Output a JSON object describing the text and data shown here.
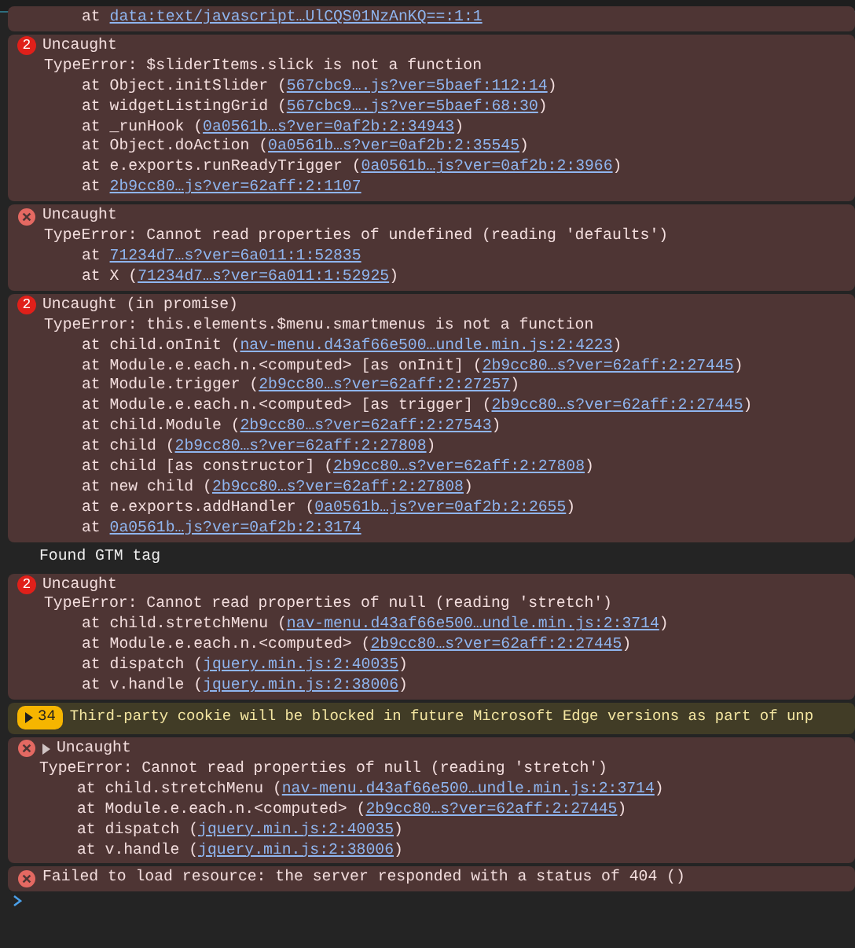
{
  "messages": [
    {
      "kind": "error",
      "toggle": false,
      "frames": [
        {
          "pre": "at ",
          "link": "data:text/javascript…UlCQS01NzAnKQ==:1:1"
        }
      ]
    },
    {
      "kind": "error",
      "toggle": false,
      "count": "2",
      "title": "Uncaught",
      "error": "TypeError: $sliderItems.slick is not a function",
      "frames": [
        {
          "pre": "at Object.initSlider (",
          "link": "567cbc9….js?ver=5baef:112:14",
          "post": ")"
        },
        {
          "pre": "at widgetListingGrid (",
          "link": "567cbc9….js?ver=5baef:68:30",
          "post": ")"
        },
        {
          "pre": "at _runHook (",
          "link": "0a0561b…s?ver=0af2b:2:34943",
          "post": ")"
        },
        {
          "pre": "at Object.doAction (",
          "link": "0a0561b…s?ver=0af2b:2:35545",
          "post": ")"
        },
        {
          "pre": "at e.exports.runReadyTrigger (",
          "link": "0a0561b…js?ver=0af2b:2:3966",
          "post": ")"
        },
        {
          "pre": "at ",
          "link": "2b9cc80…js?ver=62aff:2:1107"
        }
      ]
    },
    {
      "kind": "error",
      "toggle": false,
      "title": "Uncaught",
      "error": "TypeError: Cannot read properties of undefined (reading 'defaults')",
      "frames": [
        {
          "pre": "at ",
          "link": "71234d7…s?ver=6a011:1:52835"
        },
        {
          "pre": "at X (",
          "link": "71234d7…s?ver=6a011:1:52925",
          "post": ")"
        }
      ]
    },
    {
      "kind": "error",
      "toggle": false,
      "count": "2",
      "title": "Uncaught (in promise)",
      "error": "TypeError: this.elements.$menu.smartmenus is not a function",
      "frames": [
        {
          "pre": "at child.onInit (",
          "link": "nav-menu.d43af66e500…undle.min.js:2:4223",
          "post": ")"
        },
        {
          "pre": "at Module.e.each.n.<computed> [as onInit] (",
          "link": "2b9cc80…s?ver=62aff:2:27445",
          "post": ")"
        },
        {
          "pre": "at Module.trigger (",
          "link": "2b9cc80…s?ver=62aff:2:27257",
          "post": ")"
        },
        {
          "pre": "at Module.e.each.n.<computed> [as trigger] (",
          "link": "2b9cc80…s?ver=62aff:2:27445",
          "post": ")"
        },
        {
          "pre": "at child.Module (",
          "link": "2b9cc80…s?ver=62aff:2:27543",
          "post": ")"
        },
        {
          "pre": "at child (",
          "link": "2b9cc80…s?ver=62aff:2:27808",
          "post": ")"
        },
        {
          "pre": "at child [as constructor] (",
          "link": "2b9cc80…s?ver=62aff:2:27808",
          "post": ")"
        },
        {
          "pre": "at new child (",
          "link": "2b9cc80…s?ver=62aff:2:27808",
          "post": ")"
        },
        {
          "pre": "at e.exports.addHandler (",
          "link": "0a0561b…js?ver=0af2b:2:2655",
          "post": ")"
        },
        {
          "pre": "at ",
          "link": "0a0561b…js?ver=0af2b:2:3174"
        }
      ]
    },
    {
      "kind": "info",
      "toggle": false,
      "title": "Found GTM tag"
    },
    {
      "kind": "error",
      "toggle": false,
      "count": "2",
      "title": "Uncaught",
      "error": "TypeError: Cannot read properties of null (reading 'stretch')",
      "frames": [
        {
          "pre": "at child.stretchMenu (",
          "link": "nav-menu.d43af66e500…undle.min.js:2:3714",
          "post": ")"
        },
        {
          "pre": "at Module.e.each.n.<computed> (",
          "link": "2b9cc80…s?ver=62aff:2:27445",
          "post": ")"
        },
        {
          "pre": "at dispatch (",
          "link": "jquery.min.js:2:40035",
          "post": ")"
        },
        {
          "pre": "at v.handle (",
          "link": "jquery.min.js:2:38006",
          "post": ")"
        }
      ]
    },
    {
      "kind": "warning",
      "toggle": false,
      "count": "34",
      "title": "Third-party cookie will be blocked in future Microsoft Edge versions as part of unp"
    },
    {
      "kind": "error",
      "toggle": true,
      "title": "Uncaught",
      "error": "TypeError: Cannot read properties of null (reading 'stretch')",
      "frames": [
        {
          "pre": "at child.stretchMenu (",
          "link": "nav-menu.d43af66e500…undle.min.js:2:3714",
          "post": ")"
        },
        {
          "pre": "at Module.e.each.n.<computed> (",
          "link": "2b9cc80…s?ver=62aff:2:27445",
          "post": ")"
        },
        {
          "pre": "at dispatch (",
          "link": "jquery.min.js:2:40035",
          "post": ")"
        },
        {
          "pre": "at v.handle (",
          "link": "jquery.min.js:2:38006",
          "post": ")"
        }
      ]
    },
    {
      "kind": "error",
      "toggle": false,
      "title": "Failed to load resource: the server responded with a status of 404 ()"
    }
  ]
}
